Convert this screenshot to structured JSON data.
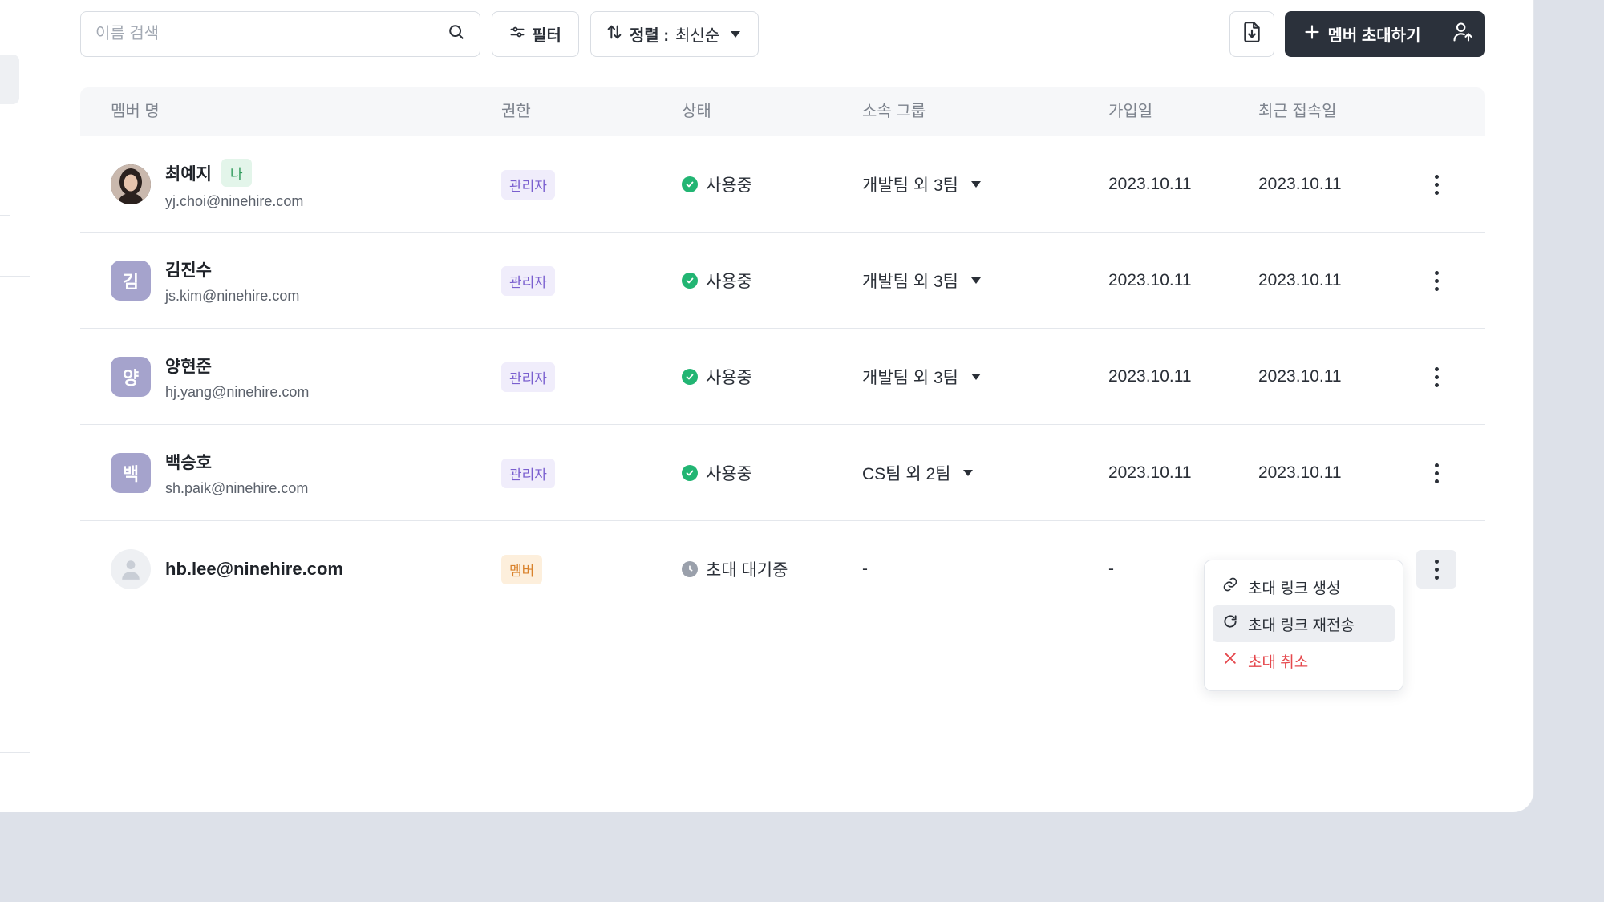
{
  "toolbar": {
    "search_placeholder": "이름 검색",
    "filter_label": "필터",
    "sort_label": "정렬 :",
    "sort_value": "최신순",
    "invite_label": "멤버 초대하기"
  },
  "table": {
    "headers": {
      "name": "멤버 명",
      "role": "권한",
      "status": "상태",
      "group": "소속 그룹",
      "joined": "가입일",
      "last_login": "최근 접속일"
    },
    "rows": [
      {
        "initial": "",
        "name": "최예지",
        "me_badge": "나",
        "email": "yj.choi@ninehire.com",
        "role": "관리자",
        "status": "사용중",
        "group": "개발팀 외 3팀",
        "joined": "2023.10.11",
        "last_login": "2023.10.11"
      },
      {
        "initial": "김",
        "name": "김진수",
        "email": "js.kim@ninehire.com",
        "role": "관리자",
        "status": "사용중",
        "group": "개발팀 외 3팀",
        "joined": "2023.10.11",
        "last_login": "2023.10.11"
      },
      {
        "initial": "양",
        "name": "양현준",
        "email": "hj.yang@ninehire.com",
        "role": "관리자",
        "status": "사용중",
        "group": "개발팀 외 3팀",
        "joined": "2023.10.11",
        "last_login": "2023.10.11"
      },
      {
        "initial": "백",
        "name": "백승호",
        "email": "sh.paik@ninehire.com",
        "role": "관리자",
        "status": "사용중",
        "group": "CS팀 외 2팀",
        "joined": "2023.10.11",
        "last_login": "2023.10.11"
      },
      {
        "email": "hb.lee@ninehire.com",
        "role": "멤버",
        "status": "초대 대기중",
        "group": "-",
        "joined": "-"
      }
    ]
  },
  "menu": {
    "items": [
      {
        "label": "초대 링크 생성",
        "icon": "link-icon"
      },
      {
        "label": "초대 링크 재전송",
        "icon": "refresh-icon"
      },
      {
        "label": "초대 취소",
        "icon": "close-icon"
      }
    ]
  },
  "colors": {
    "primary_dark": "#2b313b",
    "status_active": "#22b573",
    "danger": "#e5484d",
    "role_admin": "#7a5fcf",
    "role_member": "#d9822b"
  }
}
